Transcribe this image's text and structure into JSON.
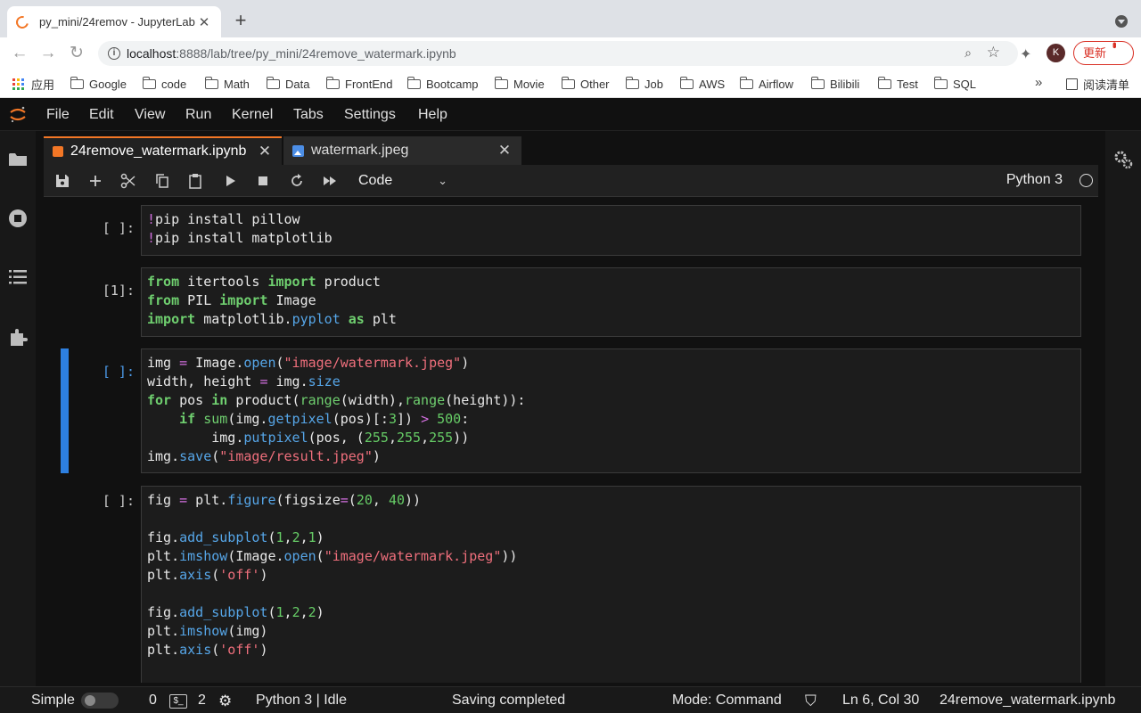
{
  "browser": {
    "tab_title": "py_mini/24remov - JupyterLab",
    "tab_close": "✕",
    "new_tab": "+",
    "url_host": "localhost",
    "url_rest": ":8888/lab/tree/py_mini/24remove_watermark.ipynb",
    "avatar_letter": "K",
    "update_label": "更新",
    "bookmarks": [
      "应用",
      "Google",
      "code",
      "Math",
      "Data",
      "FrontEnd",
      "Bootcamp",
      "Movie",
      "Other",
      "Job",
      "AWS",
      "Airflow",
      "Bilibili",
      "Test",
      "SQL"
    ],
    "bookmarks_more": "»",
    "reading_list": "阅读清单"
  },
  "menu": [
    "File",
    "Edit",
    "View",
    "Run",
    "Kernel",
    "Tabs",
    "Settings",
    "Help"
  ],
  "tabs": [
    {
      "label": "24remove_watermark.ipynb",
      "close": "✕"
    },
    {
      "label": "watermark.jpeg",
      "close": "✕"
    }
  ],
  "toolbar": {
    "cell_type": "Code",
    "kernel": "Python 3"
  },
  "cells": [
    {
      "prompt": "[ ]:"
    },
    {
      "prompt": "[1]:"
    },
    {
      "prompt": "[ ]:"
    },
    {
      "prompt": "[ ]:"
    }
  ],
  "status": {
    "mode_label": "Simple",
    "terminals": "0",
    "kernels": "2",
    "kernel_state": "Python 3 | Idle",
    "message": "Saving completed",
    "command_mode": "Mode: Command",
    "cursor": "Ln 6, Col 30",
    "filename": "24remove_watermark.ipynb"
  },
  "colors": {
    "jupyter_orange": "#f37726",
    "active_cell": "#2d7fe0",
    "keyword": "#6fcf6f",
    "string": "#ef6f7c"
  }
}
